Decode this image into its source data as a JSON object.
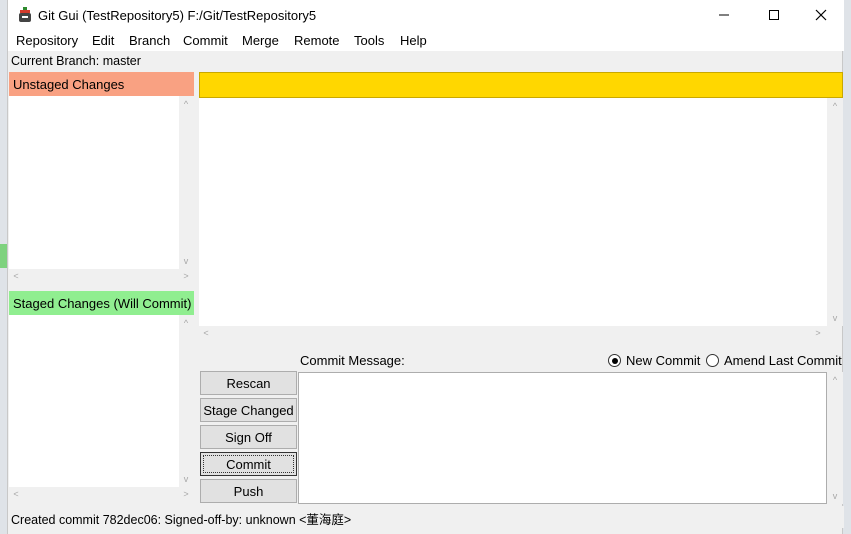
{
  "window": {
    "title": "Git Gui (TestRepository5) F:/Git/TestRepository5"
  },
  "menu": [
    "Repository",
    "Edit",
    "Branch",
    "Commit",
    "Merge",
    "Remote",
    "Tools",
    "Help"
  ],
  "branch": {
    "label": "Current Branch: master"
  },
  "unstaged": {
    "title": "Unstaged Changes"
  },
  "staged": {
    "title": "Staged Changes (Will Commit)"
  },
  "commit": {
    "message_label": "Commit Message:",
    "new_commit": "New Commit",
    "amend": "Amend Last Commit",
    "mode_selected": "New Commit"
  },
  "buttons": {
    "rescan": "Rescan",
    "stage_changed": "Stage Changed",
    "sign_off": "Sign Off",
    "commit": "Commit",
    "push": "Push"
  },
  "status": {
    "text": "Created commit 782dec06: Signed-off-by: unknown <董海庭>"
  },
  "colors": {
    "unstaged_header": "#f9a182",
    "staged_header": "#90ee90",
    "diff_header": "#ffd700"
  }
}
